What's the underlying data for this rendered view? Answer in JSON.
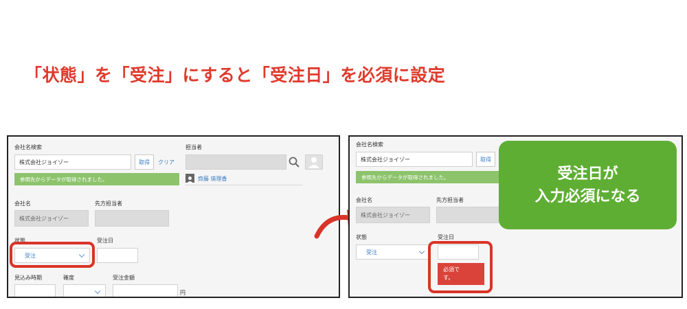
{
  "headline": "「状態」を「受注」にすると「受注日」を必須に設定",
  "left": {
    "company_search_label": "会社名検索",
    "company_search_value": "株式会社ジョイゾー",
    "get_button": "取得",
    "clear_button": "クリア",
    "notice": "参照先からデータが取得されました。",
    "owner_label": "担当者",
    "owner_name": "齊藤 瑛理香",
    "company_name_label": "会社名",
    "company_name_value": "株式会社ジョイゾー",
    "contact_label": "先方担当者",
    "status_label": "状態",
    "status_value": "受注",
    "order_date_label": "受注日",
    "expected_label": "見込み時期",
    "certainty_label": "確度",
    "amount_label": "受注金額",
    "amount_unit": "円"
  },
  "right": {
    "company_search_label": "会社名検索",
    "company_search_value": "株式会社ジョイゾー",
    "get_button": "取得",
    "notice": "参照先からデータが取得されました。",
    "company_name_label": "会社名",
    "company_name_value": "株式会社ジョイゾー",
    "contact_label": "先方担当者",
    "status_label": "状態",
    "status_value": "受注",
    "order_date_label": "受注日",
    "error_line1": "必須で",
    "error_line2": "す。"
  },
  "callout": {
    "line1": "受注日が",
    "line2": "入力必須になる"
  },
  "colors": {
    "headline": "#e03a2c",
    "highlight": "#d93428",
    "notice": "#8cc36b",
    "callout": "#5fae34",
    "error": "#d9433a",
    "link": "#3b7dc4"
  }
}
